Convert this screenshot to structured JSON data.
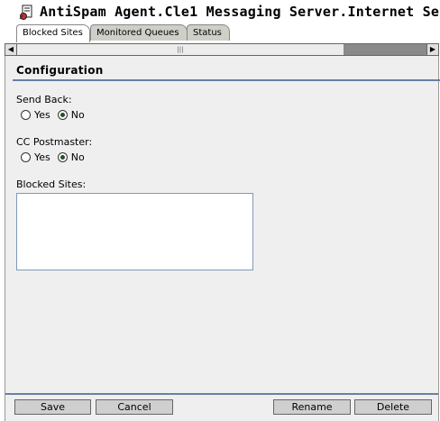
{
  "window": {
    "title": "AntiSpam Agent.Cle1 Messaging Server.Internet Serv",
    "icon": "settings-page-icon"
  },
  "tabs": [
    {
      "label": "Blocked Sites",
      "active": true
    },
    {
      "label": "Monitored Queues",
      "active": false
    },
    {
      "label": "Status",
      "active": false
    }
  ],
  "scrollbar": {
    "grip": "|||"
  },
  "section": {
    "title": "Configuration"
  },
  "send_back": {
    "label": "Send Back:",
    "options": [
      "Yes",
      "No"
    ],
    "selected": "No"
  },
  "cc_postmaster": {
    "label": "CC Postmaster:",
    "options": [
      "Yes",
      "No"
    ],
    "selected": "No"
  },
  "blocked_sites": {
    "label": "Blocked Sites:",
    "value": ""
  },
  "buttons": {
    "save": "Save",
    "cancel": "Cancel",
    "rename": "Rename",
    "delete": "Delete"
  },
  "colors": {
    "accent_rule": "#6a7fa3",
    "panel_bg": "#efefef"
  }
}
